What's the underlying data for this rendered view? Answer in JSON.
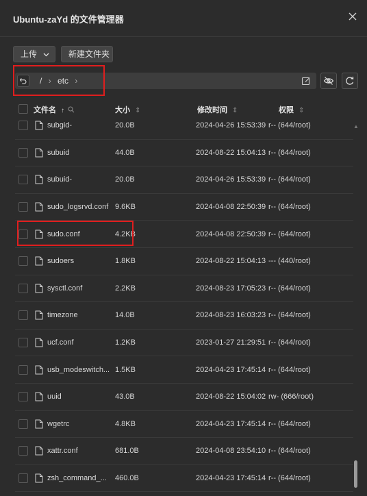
{
  "window": {
    "title": "Ubuntu-zaYd 的文件管理器"
  },
  "toolbar": {
    "upload_label": "上传",
    "new_folder_label": "新建文件夹"
  },
  "path": {
    "root": "/",
    "segment": "etc"
  },
  "columns": {
    "name": "文件名",
    "size": "大小",
    "mtime": "修改时间",
    "perm": "权限"
  },
  "files": [
    {
      "name": "subgid-",
      "size": "20.0B",
      "mtime": "2024-04-26 15:53:39",
      "perm": "r-- (644/root)"
    },
    {
      "name": "subuid",
      "size": "44.0B",
      "mtime": "2024-08-22 15:04:13",
      "perm": "r-- (644/root)"
    },
    {
      "name": "subuid-",
      "size": "20.0B",
      "mtime": "2024-04-26 15:53:39",
      "perm": "r-- (644/root)"
    },
    {
      "name": "sudo_logsrvd.conf",
      "size": "9.6KB",
      "mtime": "2024-04-08 22:50:39",
      "perm": "r-- (644/root)"
    },
    {
      "name": "sudo.conf",
      "size": "4.2KB",
      "mtime": "2024-04-08 22:50:39",
      "perm": "r-- (644/root)"
    },
    {
      "name": "sudoers",
      "size": "1.8KB",
      "mtime": "2024-08-22 15:04:13",
      "perm": "--- (440/root)"
    },
    {
      "name": "sysctl.conf",
      "size": "2.2KB",
      "mtime": "2024-08-23 17:05:23",
      "perm": "r-- (644/root)"
    },
    {
      "name": "timezone",
      "size": "14.0B",
      "mtime": "2024-08-23 16:03:23",
      "perm": "r-- (644/root)"
    },
    {
      "name": "ucf.conf",
      "size": "1.2KB",
      "mtime": "2023-01-27 21:29:51",
      "perm": "r-- (644/root)"
    },
    {
      "name": "usb_modeswitch...",
      "size": "1.5KB",
      "mtime": "2024-04-23 17:45:14",
      "perm": "r-- (644/root)"
    },
    {
      "name": "uuid",
      "size": "43.0B",
      "mtime": "2024-08-22 15:04:02",
      "perm": "rw- (666/root)"
    },
    {
      "name": "wgetrc",
      "size": "4.8KB",
      "mtime": "2024-04-23 17:45:14",
      "perm": "r-- (644/root)"
    },
    {
      "name": "xattr.conf",
      "size": "681.0B",
      "mtime": "2024-04-08 23:54:10",
      "perm": "r-- (644/root)"
    },
    {
      "name": "zsh_command_...",
      "size": "460.0B",
      "mtime": "2024-04-23 17:45:14",
      "perm": "r-- (644/root)"
    }
  ]
}
